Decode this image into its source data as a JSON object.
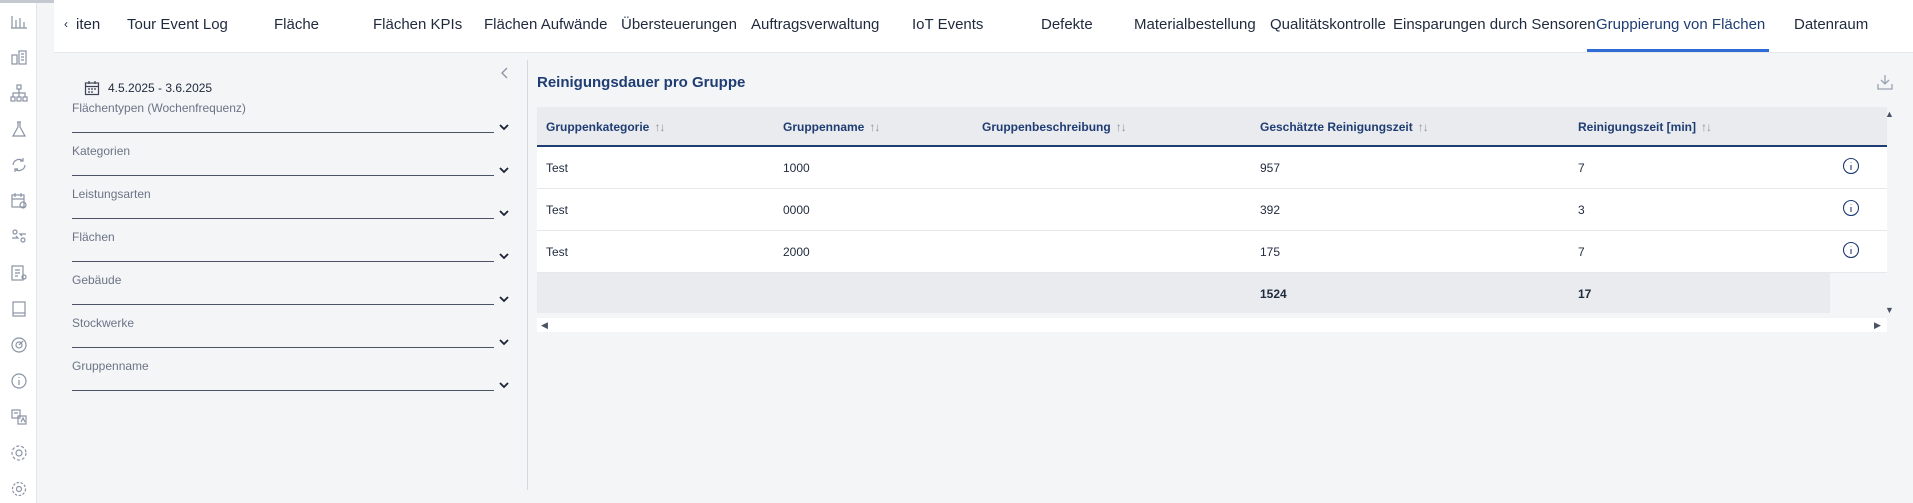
{
  "tabs": {
    "items": [
      {
        "label": "iten"
      },
      {
        "label": "Tour Event Log"
      },
      {
        "label": "Fläche"
      },
      {
        "label": "Flächen KPIs"
      },
      {
        "label": "Flächen Aufwände"
      },
      {
        "label": "Übersteuerungen"
      },
      {
        "label": "Auftragsverwaltung"
      },
      {
        "label": "IoT Events"
      },
      {
        "label": "Defekte"
      },
      {
        "label": "Materialbestellung"
      },
      {
        "label": "Qualitätskontrolle"
      },
      {
        "label": "Einsparungen durch Sensoren"
      },
      {
        "label": "Gruppierung von Flächen"
      },
      {
        "label": "Datenraum"
      }
    ],
    "active_index": 12
  },
  "filters": {
    "date_range": "4.5.2025 - 3.6.2025",
    "fields": [
      {
        "label": "Flächentypen (Wochenfrequenz)"
      },
      {
        "label": "Kategorien"
      },
      {
        "label": "Leistungsarten"
      },
      {
        "label": "Flächen"
      },
      {
        "label": "Gebäude"
      },
      {
        "label": "Stockwerke"
      },
      {
        "label": "Gruppenname"
      }
    ]
  },
  "card": {
    "title": "Reinigungsdauer pro Gruppe",
    "columns": [
      {
        "label": "Gruppenkategorie",
        "sort": "↑↓"
      },
      {
        "label": "Gruppenname",
        "sort": "↑↓"
      },
      {
        "label": "Gruppenbeschreibung",
        "sort": "↑↓"
      },
      {
        "label": "Geschätzte Reinigungszeit",
        "sort": "↑↓"
      },
      {
        "label": "Reinigungszeit [min]",
        "sort": "↑↓"
      }
    ],
    "rows": [
      {
        "kategorie": "Test",
        "name": "1000",
        "beschreibung": "",
        "geschaetzt": "957",
        "minuten": "7"
      },
      {
        "kategorie": "Test",
        "name": "0000",
        "beschreibung": "",
        "geschaetzt": "392",
        "minuten": "3"
      },
      {
        "kategorie": "Test",
        "name": "2000",
        "beschreibung": "",
        "geschaetzt": "175",
        "minuten": "7"
      }
    ],
    "totals": {
      "geschaetzt": "1524",
      "minuten": "17"
    }
  },
  "icons": {
    "rail": [
      "bar-chart-icon",
      "building-chart-icon",
      "hierarchy-icon",
      "flask-icon",
      "refresh-cycle-icon",
      "calendar-settings-icon",
      "swap-people-icon",
      "document-list-icon",
      "book-icon",
      "gauge-icon",
      "info-circle-icon",
      "translate-icon",
      "settings-group-icon",
      "gear-icon"
    ],
    "download": "download-icon",
    "info": "info-circle-icon"
  },
  "colors": {
    "accent": "#2f6cd6",
    "heading": "#1f3d73"
  }
}
